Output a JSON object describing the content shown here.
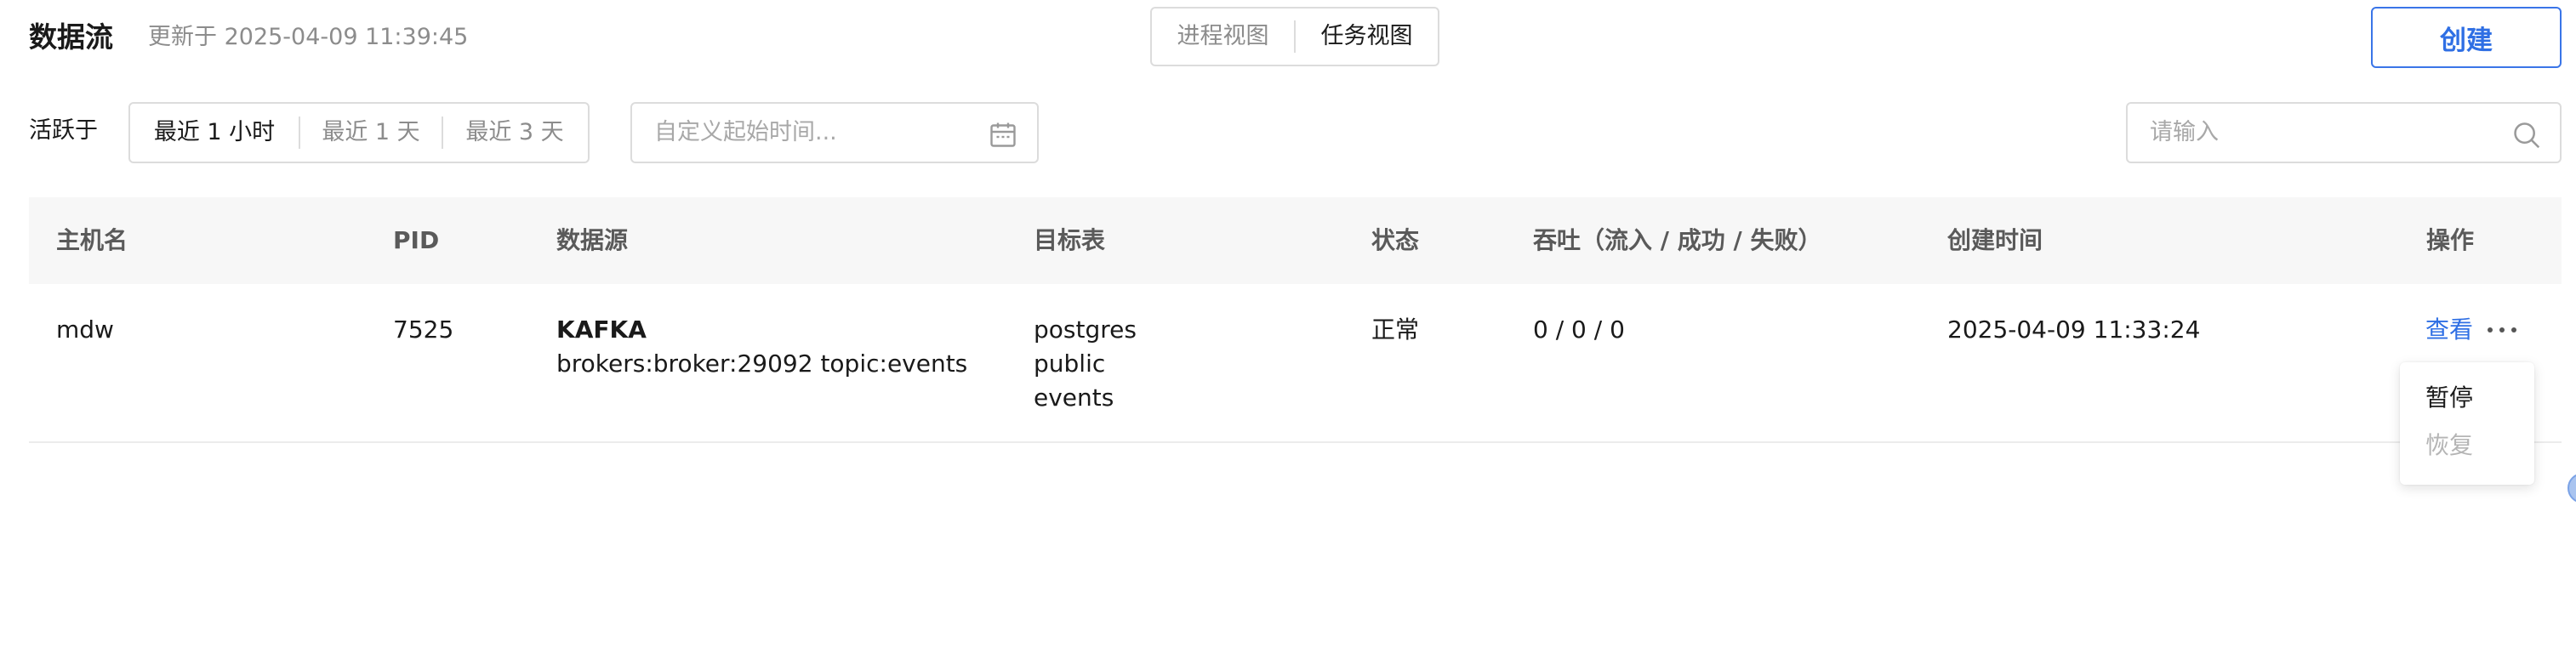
{
  "header": {
    "title": "数据流",
    "updated_at": "更新于 2025-04-09 11:39:45",
    "view_switch": [
      "进程视图",
      "任务视图"
    ],
    "create_label": "创建"
  },
  "filters": {
    "active_label": "活跃于",
    "ranges": [
      "最近 1 小时",
      "最近 1 天",
      "最近 3 天"
    ],
    "date_placeholder": "自定义起始时间...",
    "search_placeholder": "请输入"
  },
  "table": {
    "columns": [
      "主机名",
      "PID",
      "数据源",
      "目标表",
      "状态",
      "吞吐（流入 / 成功 / 失败）",
      "创建时间",
      "操作"
    ],
    "rows": [
      {
        "host": "mdw",
        "pid": "7525",
        "source_type": "KAFKA",
        "source_detail": "brokers:broker:29092 topic:events",
        "target": [
          "postgres",
          "public",
          "events"
        ],
        "status": "正常",
        "throughput": "0 / 0 / 0",
        "created_at": "2025-04-09 11:33:24",
        "actions": {
          "view": "查看"
        }
      }
    ]
  },
  "dropdown": {
    "items": [
      "暂停",
      "恢复"
    ]
  },
  "colors": {
    "accent": "#2f6fe4",
    "muted_text": "#8c8c8c",
    "header_bg": "#f7f7f7",
    "border": "#dcdcdc"
  },
  "icons": {
    "date_input": "calendar-icon",
    "search_input": "search-icon",
    "row_more": "more-horizontal-icon"
  }
}
